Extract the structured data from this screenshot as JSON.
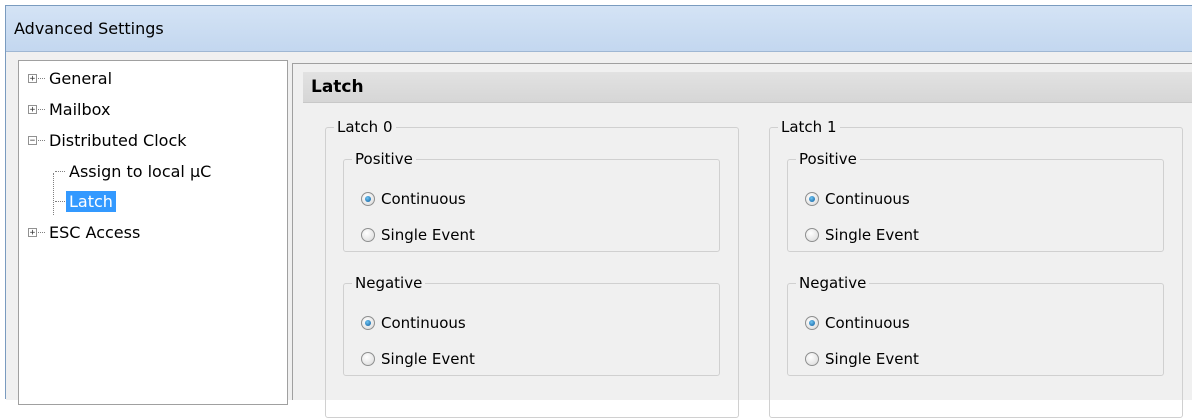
{
  "window": {
    "title": "Advanced Settings"
  },
  "tree": {
    "items": [
      {
        "label": "General",
        "expander": "+"
      },
      {
        "label": "Mailbox",
        "expander": "+"
      },
      {
        "label": "Distributed Clock",
        "expander": "−"
      },
      {
        "label": "Assign to local µC"
      },
      {
        "label": "Latch",
        "selected": true
      },
      {
        "label": "ESC Access",
        "expander": "+"
      }
    ]
  },
  "panel": {
    "title": "Latch",
    "groups": [
      {
        "title": "Latch 0",
        "positive": {
          "title": "Positive",
          "options": [
            "Continuous",
            "Single Event"
          ],
          "selected": "Continuous"
        },
        "negative": {
          "title": "Negative",
          "options": [
            "Continuous",
            "Single Event"
          ],
          "selected": "Continuous"
        }
      },
      {
        "title": "Latch 1",
        "positive": {
          "title": "Positive",
          "options": [
            "Continuous",
            "Single Event"
          ],
          "selected": "Continuous"
        },
        "negative": {
          "title": "Negative",
          "options": [
            "Continuous",
            "Single Event"
          ],
          "selected": "Continuous"
        }
      }
    ]
  },
  "colors": {
    "titlebar": "#c9dcf2",
    "selection": "#3399ff",
    "panel_bg": "#f0f0f0"
  }
}
